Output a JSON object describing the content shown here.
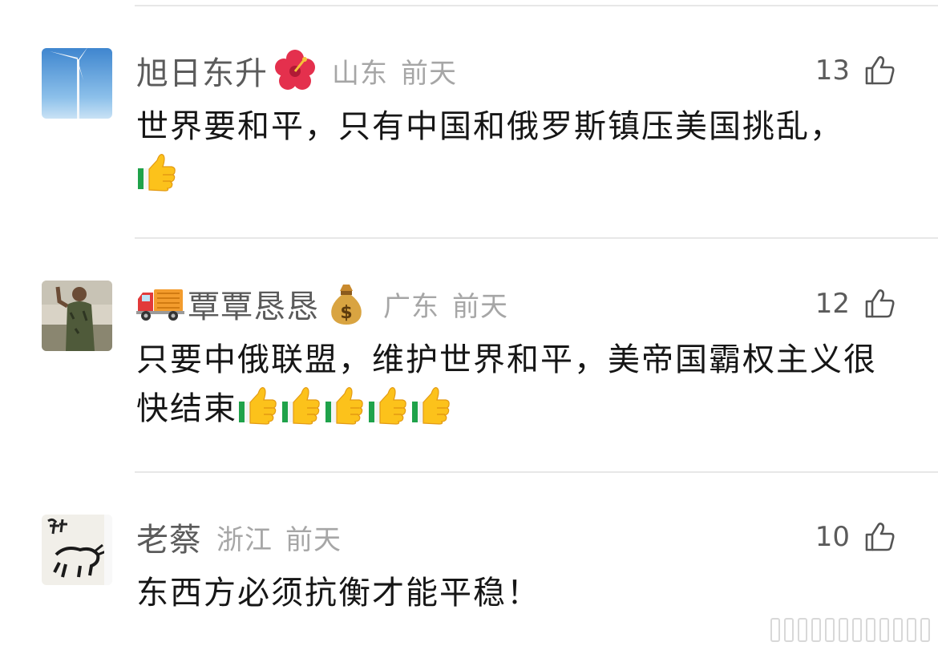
{
  "comments": [
    {
      "username": "旭日东升",
      "name_badge": "hibiscus-emoji",
      "location": "山东",
      "time": "前天",
      "likes": "13",
      "text": "世界要和平，只有中国和俄罗斯镇压美国挑乱，",
      "thumbs_up_count": 1
    },
    {
      "name_lead": "delivery-truck-emoji",
      "username": "覃覃恳恳",
      "name_badge": "money-bag-emoji",
      "location": "广东",
      "time": "前天",
      "likes": "12",
      "text": "只要中俄联盟，维护世界和平，美帝国霸权主义很快结束",
      "thumbs_up_count": 5
    },
    {
      "username": "老蔡",
      "location": "浙江",
      "time": "前天",
      "likes": "10",
      "text": "东西方必须抗衡才能平稳！",
      "thumbs_up_count": 0
    }
  ],
  "icons": {
    "like": "thumbs-up-outline-icon",
    "reaction": "thumbs-up-emoji"
  },
  "colors": {
    "username": "#5b5b5b",
    "meta": "#a6a6a6",
    "body": "#161616",
    "divider": "#e7e7e7"
  }
}
